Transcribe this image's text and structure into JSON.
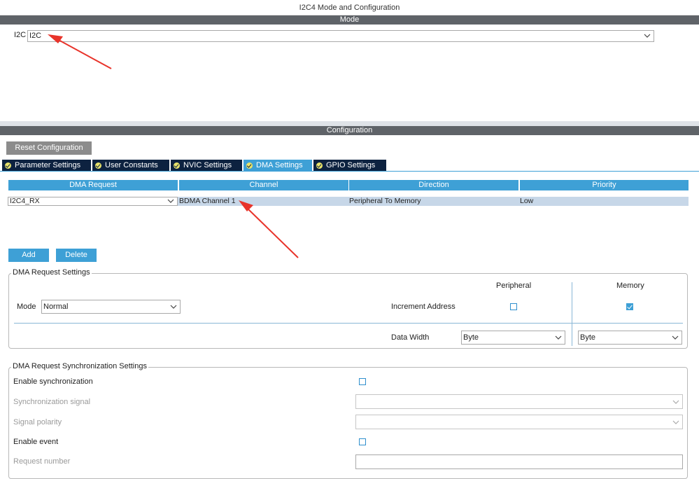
{
  "window_title": "I2C4 Mode and Configuration",
  "mode_section": {
    "title": "Mode",
    "field_label": "I2C",
    "field_value": "I2C"
  },
  "config_section": {
    "title": "Configuration",
    "reset_button": "Reset Configuration",
    "tabs": [
      {
        "label": "Parameter Settings"
      },
      {
        "label": "User Constants"
      },
      {
        "label": "NVIC Settings"
      },
      {
        "label": "DMA Settings",
        "active": true
      },
      {
        "label": "GPIO Settings"
      }
    ]
  },
  "dma_table": {
    "headers": [
      "DMA Request",
      "Channel",
      "Direction",
      "Priority"
    ],
    "rows": [
      {
        "request": "I2C4_RX",
        "channel": "BDMA Channel 1",
        "direction": "Peripheral To Memory",
        "priority": "Low"
      }
    ],
    "add_button": "Add",
    "delete_button": "Delete"
  },
  "dma_request_settings": {
    "legend": "DMA Request Settings",
    "peripheral_header": "Peripheral",
    "memory_header": "Memory",
    "mode_label": "Mode",
    "mode_value": "Normal",
    "increment_label": "Increment Address",
    "peripheral_increment": false,
    "memory_increment": true,
    "data_width_label": "Data Width",
    "peripheral_width": "Byte",
    "memory_width": "Byte"
  },
  "sync_settings": {
    "legend": "DMA Request Synchronization Settings",
    "enable_sync_label": "Enable synchronization",
    "sync_signal_label": "Synchronization signal",
    "signal_polarity_label": "Signal polarity",
    "enable_event_label": "Enable event",
    "request_number_label": "Request number"
  },
  "colors": {
    "section_bar": "#5f6368",
    "tab_dark": "#0d2240",
    "accent_blue": "#3ea0d6",
    "selected_row": "#c7d7e8",
    "annotation_arrow": "#e8332a"
  },
  "annotations": [
    "red-arrow",
    "red-arrow"
  ]
}
